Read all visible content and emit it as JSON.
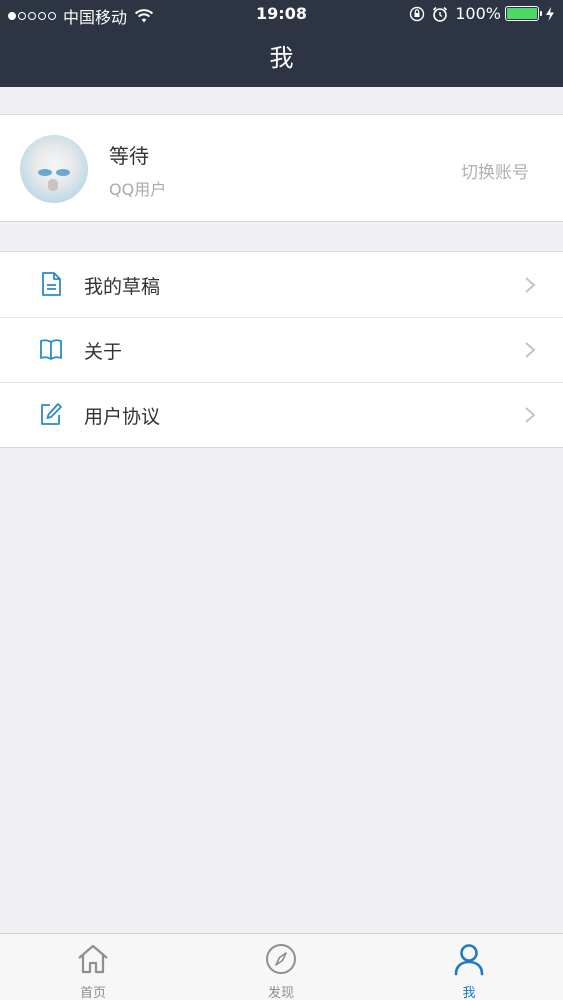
{
  "status_bar": {
    "carrier": "中国移动",
    "time": "19:08",
    "battery_percent": "100%",
    "signal_bars_filled": 1,
    "signal_bars_total": 5,
    "battery_level": 1.0,
    "battery_color": "#4cd964"
  },
  "nav": {
    "title": "我",
    "background_color": "#2d3443"
  },
  "profile": {
    "name": "等待",
    "subtitle": "QQ用户",
    "switch_account_label": "切换账号",
    "avatar_icon": "avatar-image"
  },
  "menu": {
    "items": [
      {
        "label": "我的草稿",
        "icon": "document-icon"
      },
      {
        "label": "关于",
        "icon": "book-icon"
      },
      {
        "label": "用户协议",
        "icon": "edit-icon"
      }
    ]
  },
  "tabbar": {
    "tabs": [
      {
        "label": "首页",
        "icon": "home-icon",
        "active": false
      },
      {
        "label": "发现",
        "icon": "compass-icon",
        "active": false
      },
      {
        "label": "我",
        "icon": "user-icon",
        "active": true
      }
    ],
    "active_color": "#1e7bc2",
    "inactive_color": "#8e8e93"
  }
}
